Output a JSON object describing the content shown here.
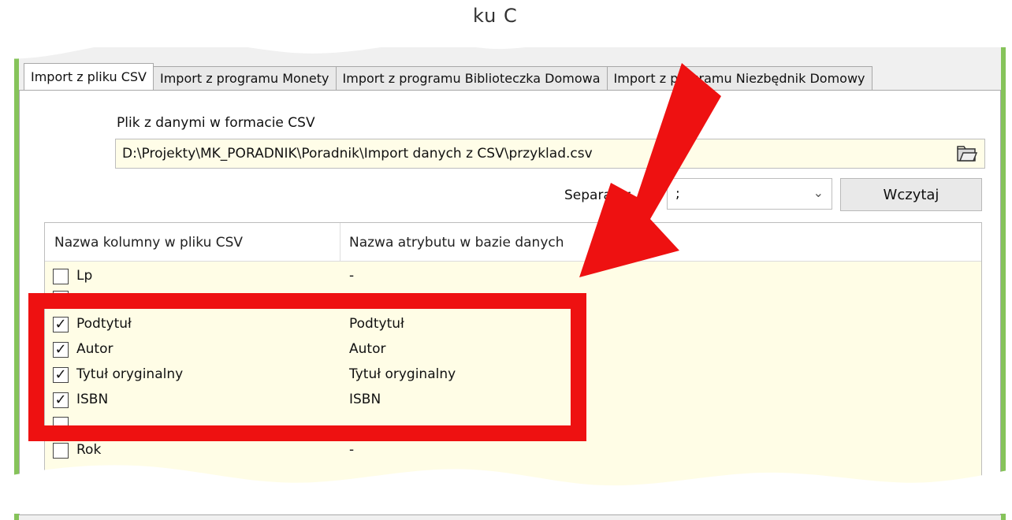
{
  "window": {
    "title_fragment": "ku C"
  },
  "tabs": [
    {
      "label": "Import z pliku CSV",
      "active": true
    },
    {
      "label": "Import z programu Monety",
      "active": false
    },
    {
      "label": "Import z programu Biblioteczka Domowa",
      "active": false
    },
    {
      "label": "Import z programu Niezbędnik Domowy",
      "active": false
    }
  ],
  "file": {
    "label": "Plik z danymi w formacie CSV",
    "path": "D:\\Projekty\\MK_PORADNIK\\Poradnik\\Import danych z CSV\\przyklad.csv",
    "browse_icon": "open-folder-icon"
  },
  "separator": {
    "label": "Separator",
    "value": ";"
  },
  "load_button": "Wczytaj",
  "grid": {
    "headers": [
      "Nazwa kolumny w pliku CSV",
      "Nazwa atrybutu w bazie danych"
    ],
    "rows": [
      {
        "name": "Lp",
        "attribute": "-",
        "checked": false
      },
      {
        "name": "Podtytuł",
        "attribute": "Podtytuł",
        "checked": true
      },
      {
        "name": "Autor",
        "attribute": "Autor",
        "checked": true
      },
      {
        "name": "Tytuł oryginalny",
        "attribute": "Tytuł oryginalny",
        "checked": true
      },
      {
        "name": "ISBN",
        "attribute": "ISBN",
        "checked": true
      },
      {
        "name": "Rok",
        "attribute": "-",
        "checked": false
      }
    ]
  },
  "annotation": {
    "color": "#ee1111",
    "frame_color": "#86c35a"
  }
}
